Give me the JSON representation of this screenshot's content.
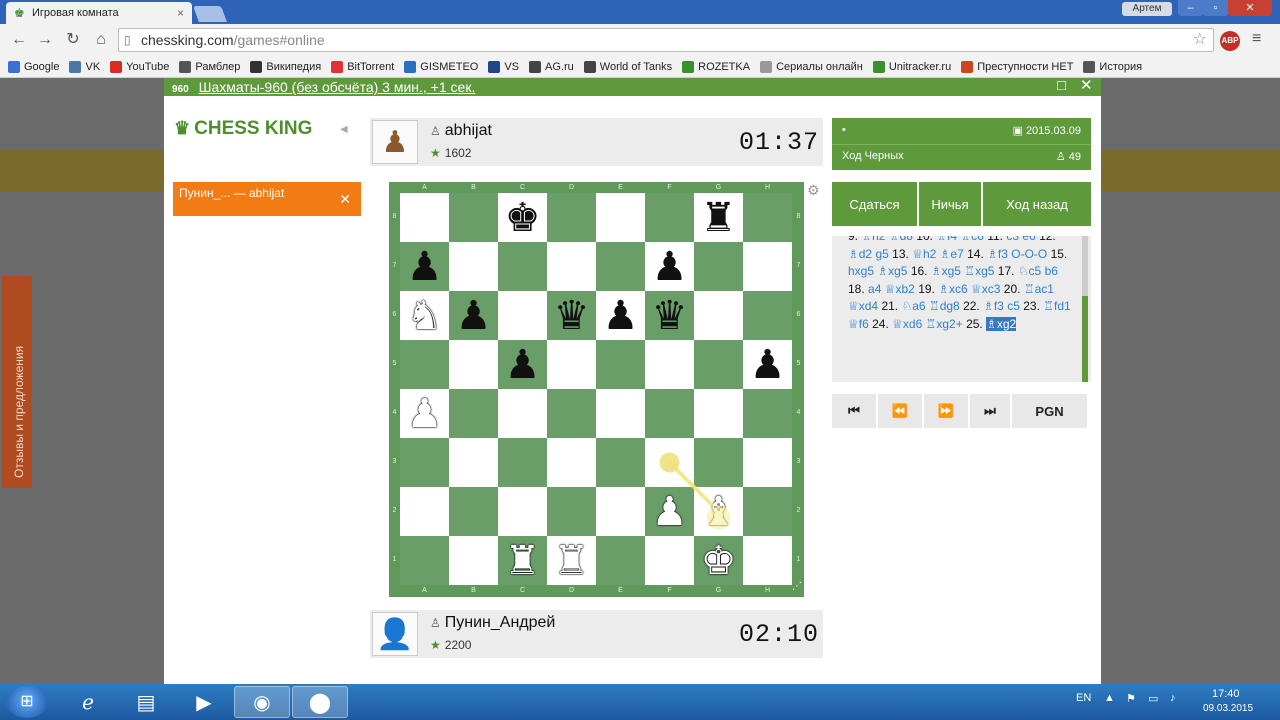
{
  "browser": {
    "tab_title": "Игровая комната",
    "tab_close": "×",
    "user_name": "Артем",
    "url_host": "chessking.com",
    "url_path": "/games#online",
    "abp_label": "ABP",
    "bookmarks": [
      {
        "label": "Google",
        "icon": "google-icon",
        "color": "#3b6fd3"
      },
      {
        "label": "VK",
        "icon": "vk-icon",
        "color": "#4a76a8"
      },
      {
        "label": "YouTube",
        "icon": "youtube-icon",
        "color": "#d92b1f"
      },
      {
        "label": "Рамблер",
        "icon": "home-icon",
        "color": "#555555"
      },
      {
        "label": "Википедия",
        "icon": "wikipedia-icon",
        "color": "#333333"
      },
      {
        "label": "BitTorrent",
        "icon": "bittorrent-icon",
        "color": "#d33"
      },
      {
        "label": "GISMETEO",
        "icon": "gismeteo-icon",
        "color": "#2a6fc0"
      },
      {
        "label": "VS",
        "icon": "vs-icon",
        "color": "#224488"
      },
      {
        "label": "AG.ru",
        "icon": "ag-icon",
        "color": "#444444"
      },
      {
        "label": "World of Tanks",
        "icon": "wot-icon",
        "color": "#444444"
      },
      {
        "label": "ROZETKA",
        "icon": "rozetka-icon",
        "color": "#3a8f2f"
      },
      {
        "label": "Сериалы онлайн",
        "icon": "page-icon",
        "color": "#999999"
      },
      {
        "label": "Unitracker.ru",
        "icon": "unitracker-icon",
        "color": "#3a8f2f"
      },
      {
        "label": "Преступности НЕТ",
        "icon": "crime-icon",
        "color": "#c42"
      },
      {
        "label": "История",
        "icon": "history-icon",
        "color": "#555555"
      }
    ]
  },
  "side_feedback": "Отзывы и предложения",
  "modal": {
    "badge": "960",
    "title": "Шахматы-960 (без обсчёта) 3 мин., +1 сек."
  },
  "logo_text": "CHESS KING",
  "game_tab": "Пунин_...  — abhijat",
  "top_player": {
    "name": "abhijat",
    "rating": "1602",
    "clock": "01:37"
  },
  "bottom_player": {
    "name": "Пунин_Андрей",
    "rating": "2200",
    "clock": "02:10"
  },
  "info": {
    "marker": "•",
    "date": "2015.03.09",
    "status": "Ход Черных",
    "count": "49"
  },
  "actions": {
    "resign": "Сдаться",
    "draw": "Ничья",
    "takeback": "Ход назад"
  },
  "moves_text": [
    {
      "t": "num",
      "v": "9."
    },
    {
      "t": "mv",
      "v": "♗h2"
    },
    {
      "t": "mv",
      "v": "♗d8"
    },
    {
      "t": "num",
      "v": "10."
    },
    {
      "t": "mv",
      "v": "♗f4"
    },
    {
      "t": "mv",
      "v": "♗c6"
    },
    {
      "t": "num",
      "v": "11."
    },
    {
      "t": "mv",
      "v": "c3"
    },
    {
      "t": "mv",
      "v": "e6"
    },
    {
      "t": "num",
      "v": "12."
    },
    {
      "t": "mv",
      "v": "♗d2"
    },
    {
      "t": "mv",
      "v": "g5"
    },
    {
      "t": "num",
      "v": "13."
    },
    {
      "t": "mv",
      "v": "♕h2"
    },
    {
      "t": "mv",
      "v": "♗e7"
    },
    {
      "t": "num",
      "v": "14."
    },
    {
      "t": "mv",
      "v": "♗f3"
    },
    {
      "t": "mv",
      "v": "O-O-O"
    },
    {
      "t": "num",
      "v": "15."
    },
    {
      "t": "mv",
      "v": "hxg5"
    },
    {
      "t": "mv",
      "v": "♗xg5"
    },
    {
      "t": "num",
      "v": "16."
    },
    {
      "t": "mv",
      "v": "♗xg5"
    },
    {
      "t": "mv",
      "v": "♖xg5"
    },
    {
      "t": "num",
      "v": "17."
    },
    {
      "t": "mv",
      "v": "♘c5"
    },
    {
      "t": "mv",
      "v": "b6"
    },
    {
      "t": "num",
      "v": "18."
    },
    {
      "t": "mv",
      "v": "a4"
    },
    {
      "t": "mv",
      "v": "♕xb2"
    },
    {
      "t": "num",
      "v": "19."
    },
    {
      "t": "mv",
      "v": "♗xc6"
    },
    {
      "t": "mv",
      "v": "♕xc3"
    },
    {
      "t": "num",
      "v": "20."
    },
    {
      "t": "mv",
      "v": "♖ac1"
    },
    {
      "t": "mv",
      "v": "♕xd4"
    },
    {
      "t": "num",
      "v": "21."
    },
    {
      "t": "mv",
      "v": "♘a6"
    },
    {
      "t": "mv",
      "v": "♖dg8"
    },
    {
      "t": "num",
      "v": "22."
    },
    {
      "t": "mv",
      "v": "♗f3"
    },
    {
      "t": "mv",
      "v": "c5"
    },
    {
      "t": "num",
      "v": "23."
    },
    {
      "t": "mv",
      "v": "♖fd1"
    },
    {
      "t": "mv",
      "v": "♕f6"
    },
    {
      "t": "num",
      "v": "24."
    },
    {
      "t": "mv",
      "v": "♕xd6"
    },
    {
      "t": "mv",
      "v": "♖xg2+"
    },
    {
      "t": "num",
      "v": "25."
    },
    {
      "t": "cur",
      "v": "♗xg2"
    }
  ],
  "nav": {
    "first": "⏮",
    "prev": "⏪",
    "next": "⏩",
    "last": "⏭",
    "pgn": "PGN"
  },
  "board": {
    "files": [
      "A",
      "B",
      "C",
      "D",
      "E",
      "F",
      "G",
      "H"
    ],
    "ranks": [
      "8",
      "7",
      "6",
      "5",
      "4",
      "3",
      "2",
      "1"
    ],
    "position": [
      [
        "",
        "",
        "bk",
        "",
        "",
        "",
        "br",
        ""
      ],
      [
        "bp",
        "",
        "",
        "",
        "",
        "bp",
        "",
        ""
      ],
      [
        "wn",
        "bp",
        "",
        "bq",
        "bp",
        "bq",
        "",
        ""
      ],
      [
        "",
        "",
        "bp",
        "",
        "",
        "",
        "",
        "bp"
      ],
      [
        "wp",
        "",
        "",
        "",
        "",
        "",
        "",
        ""
      ],
      [
        "",
        "",
        "",
        "",
        "",
        "",
        "",
        ""
      ],
      [
        "",
        "",
        "",
        "",
        "",
        "wp",
        "wb",
        ""
      ],
      [
        "",
        "",
        "wr",
        "wr",
        "",
        "",
        "wk",
        ""
      ]
    ],
    "last_move_from": "f3",
    "last_move_to": "g2"
  },
  "taskbar": {
    "lang": "EN",
    "time": "17:40",
    "date": "09.03.2015"
  }
}
